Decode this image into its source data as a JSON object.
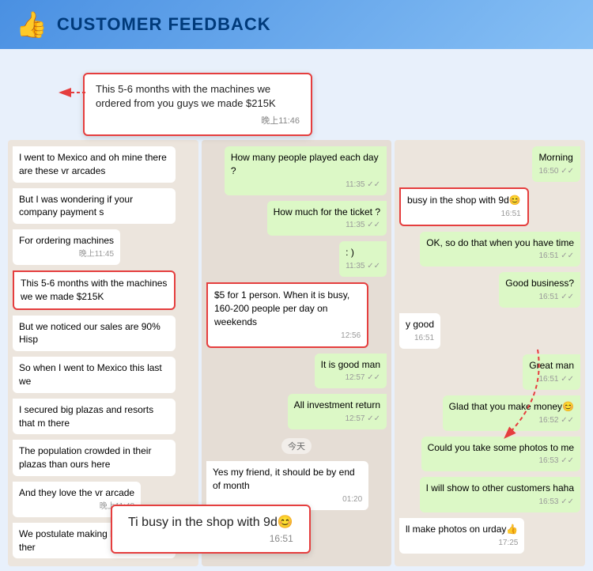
{
  "header": {
    "icon": "👍",
    "title": "CUSTOMER FEEDBACK"
  },
  "highlight_top": {
    "text": "This 5-6 months with the machines we ordered from you guys we made $215K",
    "time": "晚上11:46"
  },
  "highlight_bottom": {
    "text": "Ti busy in the shop with 9d😊",
    "time": "16:51"
  },
  "left_panel": {
    "bubbles": [
      {
        "type": "received",
        "text": "I went to Mexico and oh mine there are these vr arcades",
        "time": ""
      },
      {
        "type": "received",
        "text": "But I was wondering if your company payment s",
        "time": ""
      },
      {
        "type": "received",
        "text": "For ordering machines",
        "time": "晚上11:45"
      },
      {
        "type": "received",
        "text": "This 5-6 months with the machines we we made $215K",
        "time": "",
        "highlighted": true
      },
      {
        "type": "received",
        "text": "But we noticed our sales are 90% Hisp",
        "time": ""
      },
      {
        "type": "received",
        "text": "So when I went to Mexico this last we",
        "time": ""
      },
      {
        "type": "received",
        "text": "I secured big plazas and resorts that m there",
        "time": ""
      },
      {
        "type": "received",
        "text": "The population crowded in their plazas than ours here",
        "time": ""
      },
      {
        "type": "received",
        "text": "And they love the vr arcade",
        "time": "晚上11:48"
      },
      {
        "type": "received",
        "text": "We postulate making lots of sales ther",
        "time": ""
      }
    ]
  },
  "mid_panel": {
    "bubbles": [
      {
        "type": "sent",
        "text": "How many people played each day ?",
        "time": "11:35",
        "checks": "✓✓"
      },
      {
        "type": "sent",
        "text": "How much for the ticket ?",
        "time": "11:35",
        "checks": "✓✓"
      },
      {
        "type": "sent",
        "text": ": )",
        "time": "11:35",
        "checks": "✓✓"
      },
      {
        "type": "received",
        "text": "$5 for 1 person. When it is busy, 160-200 people per day on weekends",
        "time": "12:56",
        "highlighted": true
      },
      {
        "type": "sent",
        "text": "It is good man",
        "time": "12:57",
        "checks": "✓✓"
      },
      {
        "type": "sent",
        "text": "All investment return",
        "time": "12:57",
        "checks": "✓✓"
      },
      {
        "type": "day",
        "text": "今天"
      },
      {
        "type": "received",
        "text": "Yes my friend, it should be by end of month",
        "time": "01:20"
      }
    ]
  },
  "right_panel": {
    "bubbles": [
      {
        "type": "sent",
        "text": "Morning",
        "time": "16:50",
        "checks": "✓✓"
      },
      {
        "type": "received",
        "text": "busy in the shop with 9d😊",
        "time": "16:51",
        "highlighted": true
      },
      {
        "type": "sent",
        "text": "OK, so do that when you have time",
        "time": "16:51",
        "checks": "✓✓"
      },
      {
        "type": "sent",
        "text": "Good business?",
        "time": "16:51",
        "checks": "✓✓"
      },
      {
        "type": "received",
        "text": "y good",
        "time": "16:51"
      },
      {
        "type": "sent",
        "text": "Great man",
        "time": "16:51",
        "checks": "✓✓"
      },
      {
        "type": "sent",
        "text": "Glad that you make money😊",
        "time": "16:52",
        "checks": "✓✓"
      },
      {
        "type": "sent",
        "text": "Could you take some photos to me",
        "time": "16:53",
        "checks": "✓✓"
      },
      {
        "type": "sent",
        "text": "I will show to other customers haha",
        "time": "16:53",
        "checks": "✓✓"
      },
      {
        "type": "received",
        "text": "ll make photos on urday👍",
        "time": "17:25"
      }
    ]
  }
}
